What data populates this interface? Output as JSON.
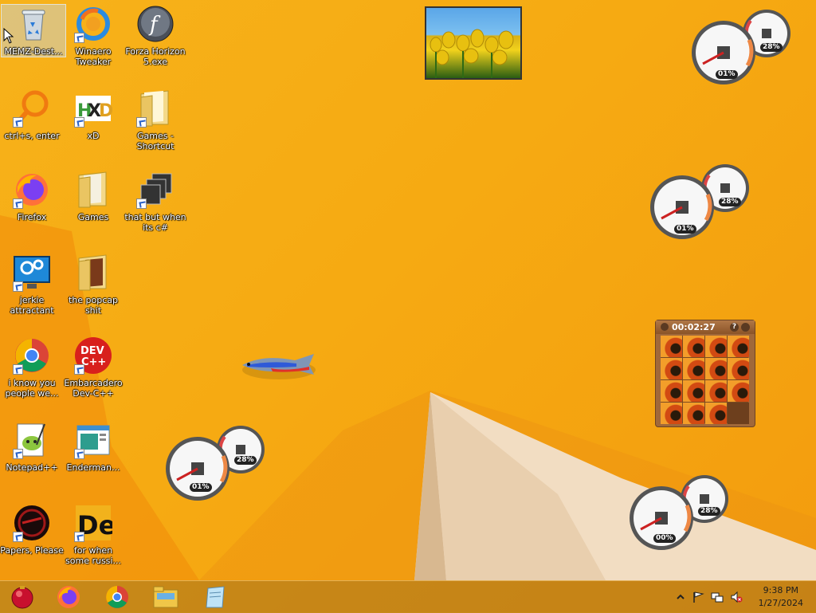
{
  "desktop": {
    "icons": [
      {
        "label": "MEMZ-Dest...",
        "icon": "recycle-bin-icon"
      },
      {
        "label": "Winaero Tweaker",
        "icon": "winaero-tweaker-icon"
      },
      {
        "label": "Forza Horizon 5.exe",
        "icon": "flash-icon"
      },
      {
        "label": "ctrl+s, enter",
        "icon": "magnifier-icon"
      },
      {
        "label": "xD",
        "icon": "hxd-icon"
      },
      {
        "label": "Games - Shortcut",
        "icon": "folder-icon"
      },
      {
        "label": "Firefox",
        "icon": "firefox-icon"
      },
      {
        "label": "Games",
        "icon": "folder-icon"
      },
      {
        "label": "that but when its c#",
        "icon": "windows-stack-icon"
      },
      {
        "label": "jerkie attractant",
        "icon": "monitor-gears-icon"
      },
      {
        "label": "the popcap shit",
        "icon": "folder-icon"
      },
      {
        "label": "i know you people we...",
        "icon": "chrome-icon"
      },
      {
        "label": "Embarcadero Dev-C++",
        "icon": "devcpp-icon"
      },
      {
        "label": "Notepad++",
        "icon": "notepad-plus-plus-icon"
      },
      {
        "label": "Enderman...",
        "icon": "app-window-icon"
      },
      {
        "label": "Papers, Please",
        "icon": "papers-please-icon"
      },
      {
        "label": "for when some russi...",
        "icon": "de-icon"
      }
    ]
  },
  "gadgets": {
    "cpu_meters": [
      {
        "cpu": "01%",
        "memory": "28%"
      },
      {
        "cpu": "01%",
        "memory": "28%"
      },
      {
        "cpu": "01%",
        "memory": "28%"
      },
      {
        "cpu": "00%",
        "memory": "28%"
      }
    ],
    "puzzle": {
      "timer": "00:02:27",
      "help_icon": "?",
      "picture_icon": "picture-icon"
    }
  },
  "taskbar": {
    "items": [
      "start-orb-icon",
      "firefox-icon",
      "chrome-icon",
      "file-explorer-icon",
      "notepad-icon"
    ],
    "tray": {
      "time": "9:38 PM",
      "date": "1/27/2024"
    }
  },
  "colors": {
    "wallpaper": "#f6aa12",
    "wallpaper_light": "#f4d9b8",
    "taskbar": "#a06e1e"
  }
}
